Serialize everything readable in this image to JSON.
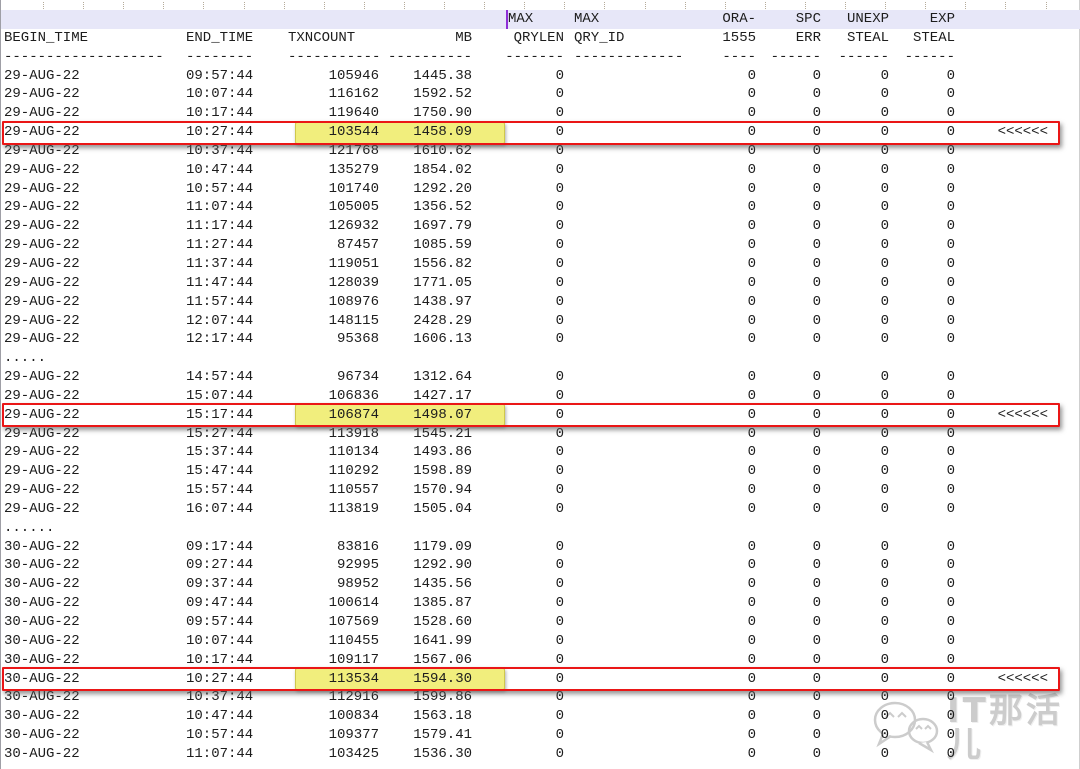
{
  "editor": {
    "active_line_color": "#e7e7f8",
    "caret_color": "#8e2fd6"
  },
  "table": {
    "header_line1": [
      "",
      "",
      "",
      "",
      "MAX",
      "MAX",
      "ORA-",
      "SPC",
      "UNEXP",
      "EXP",
      ""
    ],
    "header_line2": [
      "BEGIN_TIME",
      "END_TIME",
      "TXNCOUNT",
      "MB",
      "QRYLEN",
      "QRY_ID",
      "1555",
      "ERR",
      "STEAL",
      "STEAL",
      ""
    ],
    "separators": [
      "-------------------",
      "--------",
      "-----------",
      "----------",
      "-------",
      "-------------",
      "----",
      "------",
      "------",
      "------",
      ""
    ],
    "column_names": [
      "BEGIN_TIME",
      "END_TIME",
      "TXNCOUNT",
      "MB",
      "MAX QRYLEN",
      "MAX QRY_ID",
      "ORA-1555",
      "SPC ERR",
      "UNEXP STEAL",
      "EXP STEAL",
      "marker"
    ],
    "marker_text": "<<<<<<",
    "rows": [
      {
        "cells": [
          "29-AUG-22",
          "09:57:44",
          "105946",
          "1445.38",
          "0",
          "",
          "0",
          "0",
          "0",
          "0",
          ""
        ]
      },
      {
        "cells": [
          "29-AUG-22",
          "10:07:44",
          "116162",
          "1592.52",
          "0",
          "",
          "0",
          "0",
          "0",
          "0",
          ""
        ]
      },
      {
        "cells": [
          "29-AUG-22",
          "10:17:44",
          "119640",
          "1750.90",
          "0",
          "",
          "0",
          "0",
          "0",
          "0",
          ""
        ]
      },
      {
        "cells": [
          "29-AUG-22",
          "10:27:44",
          "103544",
          "1458.09",
          "0",
          "",
          "0",
          "0",
          "0",
          "0",
          "<<<<<<"
        ],
        "boxed": true,
        "highlight": true
      },
      {
        "cells": [
          "29-AUG-22",
          "10:37:44",
          "121768",
          "1610.62",
          "0",
          "",
          "0",
          "0",
          "0",
          "0",
          ""
        ]
      },
      {
        "cells": [
          "29-AUG-22",
          "10:47:44",
          "135279",
          "1854.02",
          "0",
          "",
          "0",
          "0",
          "0",
          "0",
          ""
        ]
      },
      {
        "cells": [
          "29-AUG-22",
          "10:57:44",
          "101740",
          "1292.20",
          "0",
          "",
          "0",
          "0",
          "0",
          "0",
          ""
        ]
      },
      {
        "cells": [
          "29-AUG-22",
          "11:07:44",
          "105005",
          "1356.52",
          "0",
          "",
          "0",
          "0",
          "0",
          "0",
          ""
        ]
      },
      {
        "cells": [
          "29-AUG-22",
          "11:17:44",
          "126932",
          "1697.79",
          "0",
          "",
          "0",
          "0",
          "0",
          "0",
          ""
        ]
      },
      {
        "cells": [
          "29-AUG-22",
          "11:27:44",
          "87457",
          "1085.59",
          "0",
          "",
          "0",
          "0",
          "0",
          "0",
          ""
        ]
      },
      {
        "cells": [
          "29-AUG-22",
          "11:37:44",
          "119051",
          "1556.82",
          "0",
          "",
          "0",
          "0",
          "0",
          "0",
          ""
        ]
      },
      {
        "cells": [
          "29-AUG-22",
          "11:47:44",
          "128039",
          "1771.05",
          "0",
          "",
          "0",
          "0",
          "0",
          "0",
          ""
        ]
      },
      {
        "cells": [
          "29-AUG-22",
          "11:57:44",
          "108976",
          "1438.97",
          "0",
          "",
          "0",
          "0",
          "0",
          "0",
          ""
        ]
      },
      {
        "cells": [
          "29-AUG-22",
          "12:07:44",
          "148115",
          "2428.29",
          "0",
          "",
          "0",
          "0",
          "0",
          "0",
          ""
        ]
      },
      {
        "cells": [
          "29-AUG-22",
          "12:17:44",
          "95368",
          "1606.13",
          "0",
          "",
          "0",
          "0",
          "0",
          "0",
          ""
        ]
      },
      {
        "cells": [
          ".....",
          "",
          "",
          "",
          "",
          "",
          "",
          "",
          "",
          "",
          ""
        ],
        "ellipsis": true
      },
      {
        "cells": [
          "29-AUG-22",
          "14:57:44",
          "96734",
          "1312.64",
          "0",
          "",
          "0",
          "0",
          "0",
          "0",
          ""
        ]
      },
      {
        "cells": [
          "29-AUG-22",
          "15:07:44",
          "106836",
          "1427.17",
          "0",
          "",
          "0",
          "0",
          "0",
          "0",
          ""
        ]
      },
      {
        "cells": [
          "29-AUG-22",
          "15:17:44",
          "106874",
          "1498.07",
          "0",
          "",
          "0",
          "0",
          "0",
          "0",
          "<<<<<<"
        ],
        "boxed": true,
        "highlight": true
      },
      {
        "cells": [
          "29-AUG-22",
          "15:27:44",
          "113918",
          "1545.21",
          "0",
          "",
          "0",
          "0",
          "0",
          "0",
          ""
        ]
      },
      {
        "cells": [
          "29-AUG-22",
          "15:37:44",
          "110134",
          "1493.86",
          "0",
          "",
          "0",
          "0",
          "0",
          "0",
          ""
        ]
      },
      {
        "cells": [
          "29-AUG-22",
          "15:47:44",
          "110292",
          "1598.89",
          "0",
          "",
          "0",
          "0",
          "0",
          "0",
          ""
        ]
      },
      {
        "cells": [
          "29-AUG-22",
          "15:57:44",
          "110557",
          "1570.94",
          "0",
          "",
          "0",
          "0",
          "0",
          "0",
          ""
        ]
      },
      {
        "cells": [
          "29-AUG-22",
          "16:07:44",
          "113819",
          "1505.04",
          "0",
          "",
          "0",
          "0",
          "0",
          "0",
          ""
        ]
      },
      {
        "cells": [
          "......",
          "",
          "",
          "",
          "",
          "",
          "",
          "",
          "",
          "",
          ""
        ],
        "ellipsis": true
      },
      {
        "cells": [
          "30-AUG-22",
          "09:17:44",
          "83816",
          "1179.09",
          "0",
          "",
          "0",
          "0",
          "0",
          "0",
          ""
        ]
      },
      {
        "cells": [
          "30-AUG-22",
          "09:27:44",
          "92995",
          "1292.90",
          "0",
          "",
          "0",
          "0",
          "0",
          "0",
          ""
        ]
      },
      {
        "cells": [
          "30-AUG-22",
          "09:37:44",
          "98952",
          "1435.56",
          "0",
          "",
          "0",
          "0",
          "0",
          "0",
          ""
        ]
      },
      {
        "cells": [
          "30-AUG-22",
          "09:47:44",
          "100614",
          "1385.87",
          "0",
          "",
          "0",
          "0",
          "0",
          "0",
          ""
        ]
      },
      {
        "cells": [
          "30-AUG-22",
          "09:57:44",
          "107569",
          "1528.60",
          "0",
          "",
          "0",
          "0",
          "0",
          "0",
          ""
        ]
      },
      {
        "cells": [
          "30-AUG-22",
          "10:07:44",
          "110455",
          "1641.99",
          "0",
          "",
          "0",
          "0",
          "0",
          "0",
          ""
        ]
      },
      {
        "cells": [
          "30-AUG-22",
          "10:17:44",
          "109117",
          "1567.06",
          "0",
          "",
          "0",
          "0",
          "0",
          "0",
          ""
        ]
      },
      {
        "cells": [
          "30-AUG-22",
          "10:27:44",
          "113534",
          "1594.30",
          "0",
          "",
          "0",
          "0",
          "0",
          "0",
          "<<<<<<"
        ],
        "boxed": true,
        "highlight": true
      },
      {
        "cells": [
          "30-AUG-22",
          "10:37:44",
          "112916",
          "1599.86",
          "0",
          "",
          "0",
          "0",
          "0",
          "0",
          ""
        ]
      },
      {
        "cells": [
          "30-AUG-22",
          "10:47:44",
          "100834",
          "1563.18",
          "0",
          "",
          "0",
          "0",
          "0",
          "0",
          ""
        ]
      },
      {
        "cells": [
          "30-AUG-22",
          "10:57:44",
          "109377",
          "1579.41",
          "0",
          "",
          "0",
          "0",
          "0",
          "0",
          ""
        ]
      },
      {
        "cells": [
          "30-AUG-22",
          "11:07:44",
          "103425",
          "1536.30",
          "0",
          "",
          "0",
          "0",
          "0",
          "0",
          ""
        ]
      }
    ]
  },
  "annotations": {
    "highlight_color": "#f1ee7d",
    "box_color": "#ea1616"
  },
  "watermark": {
    "text": "IT那活儿"
  }
}
